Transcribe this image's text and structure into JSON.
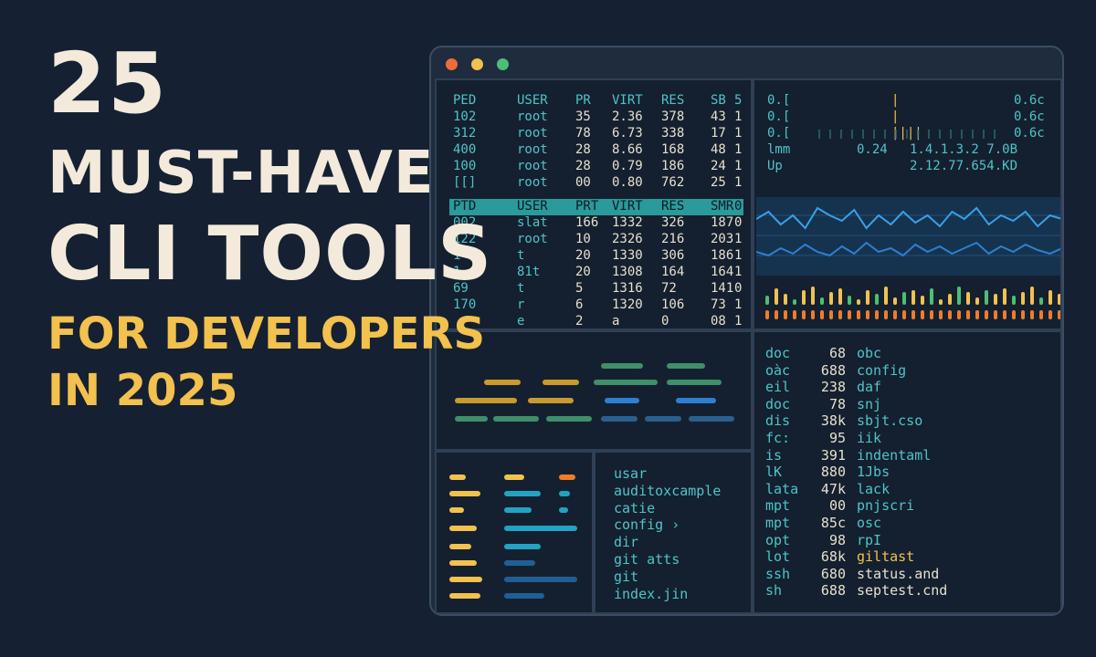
{
  "headline": {
    "number": "25",
    "line1": "MUST-HAVE",
    "line2": "CLI TOOLS",
    "sub1": "FOR DEVELOPERS",
    "sub2": "IN 2025"
  },
  "colors": {
    "background": "#152032",
    "accent_yellow": "#f2c14e",
    "accent_teal": "#4fc3c8",
    "accent_blue": "#2f7fd1",
    "accent_orange": "#f07c2a",
    "accent_green": "#3f8f6a"
  },
  "window_controls": [
    {
      "name": "close",
      "color": "#ef6b3a"
    },
    {
      "name": "minimize",
      "color": "#f2c14e"
    },
    {
      "name": "maximize",
      "color": "#4cbf73"
    }
  ],
  "process_table_top": {
    "headers": [
      "PED",
      "USER",
      "PR",
      "VIRT",
      "RES",
      "SB",
      "5"
    ],
    "rows": [
      [
        "102",
        "root",
        "35",
        "2.36",
        "378",
        "43",
        "1"
      ],
      [
        "312",
        "root",
        "78",
        "6.73",
        "338",
        "17",
        "1"
      ],
      [
        "400",
        "root",
        "28",
        "8.66",
        "168",
        "48",
        "1"
      ],
      [
        "100",
        "root",
        "28",
        "0.79",
        "186",
        "24",
        "1"
      ],
      [
        "[[]",
        "root",
        "00",
        "0.80",
        "762",
        "25",
        "1"
      ]
    ]
  },
  "process_table_bottom": {
    "headers": [
      "PTD",
      "USER",
      "PRT",
      "VIRT",
      "RES",
      "SMR",
      "0"
    ],
    "rows": [
      [
        "002",
        "slat",
        "166",
        "1332",
        "326",
        "187",
        "0"
      ],
      [
        "122",
        "root",
        "10",
        "2326",
        "216",
        "203",
        "1"
      ],
      [
        "1",
        "t",
        "20",
        "1330",
        "306",
        "186",
        "1"
      ],
      [
        "1",
        "81t",
        "20",
        "1308",
        "164",
        "164",
        "1"
      ],
      [
        "69",
        "t",
        "5",
        "1316",
        "72",
        "141",
        "0"
      ],
      [
        "170",
        "r",
        "6",
        "1320",
        "106",
        "73",
        "1"
      ],
      [
        "",
        "e",
        "2",
        "a",
        "0",
        "08",
        "1"
      ]
    ]
  },
  "cpu_stats": [
    {
      "label": "0.[",
      "meter": "|",
      "value": "0.6c"
    },
    {
      "label": "0.[",
      "meter": "|",
      "value": "0.6c"
    },
    {
      "label": "0.[",
      "meter": "||||",
      "value": "0.6c"
    }
  ],
  "mem_stats": [
    {
      "label": "lmm",
      "value1": "0.24",
      "value2": "1.4.1.3.2 7.0B"
    },
    {
      "label": "Up",
      "value1": "",
      "value2": "2.12.77.654.KD"
    }
  ],
  "graph": {
    "series_a": [
      34,
      26,
      40,
      30,
      44,
      22,
      30,
      36,
      24,
      44,
      30,
      40,
      26,
      38,
      30,
      42,
      26,
      34,
      22,
      40,
      30,
      36,
      26,
      42,
      30,
      34
    ],
    "series_b": [
      70,
      74,
      66,
      72,
      62,
      70,
      74,
      64,
      72,
      60,
      70,
      66,
      74,
      62,
      70,
      64,
      72,
      66,
      60,
      72,
      64,
      70,
      62,
      68,
      72,
      66
    ],
    "activity": [
      10,
      18,
      12,
      6,
      16,
      20,
      8,
      14,
      18,
      10,
      6,
      16,
      12,
      20,
      8,
      14,
      16,
      10,
      18,
      6,
      12,
      20,
      14,
      8,
      16,
      12,
      18,
      10,
      14,
      20,
      8,
      16,
      12
    ]
  },
  "file_list": [
    {
      "type": "doc",
      "size": "68",
      "name": "obc"
    },
    {
      "type": "oàc",
      "size": "688",
      "name": "config"
    },
    {
      "type": "eil",
      "size": "238",
      "name": "daf"
    },
    {
      "type": "doc",
      "size": "78",
      "name": "snj"
    },
    {
      "type": "dis",
      "size": "38k",
      "name": "sbjt.cso"
    },
    {
      "type": "fc:",
      "size": "95",
      "name": "iik"
    },
    {
      "type": "is",
      "size": "391",
      "name": "indentaml"
    },
    {
      "type": "lK",
      "size": "880",
      "name": "1Jbs"
    },
    {
      "type": "lata",
      "size": "47k",
      "name": "lack"
    },
    {
      "type": "mpt",
      "size": "00",
      "name": "pnjscri"
    },
    {
      "type": "mpt",
      "size": "85c",
      "name": "osc"
    },
    {
      "type": "opt",
      "size": "98",
      "name": "rpI"
    },
    {
      "type": "lot",
      "size": "68k",
      "name": "giltast"
    },
    {
      "type": "ssh",
      "size": "680",
      "name": "status.and"
    },
    {
      "type": "sh",
      "size": "688",
      "name": "septest.cnd"
    }
  ],
  "git_list": [
    "usar",
    "auditoxcample",
    "catie",
    "config ›",
    "dir",
    "git atts",
    "git",
    "index.jin"
  ]
}
